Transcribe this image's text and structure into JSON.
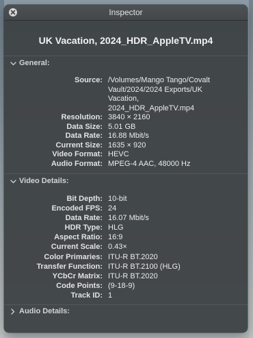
{
  "window": {
    "title": "Inspector",
    "file_name": "UK Vacation, 2024_HDR_AppleTV.mp4"
  },
  "general": {
    "header": "General:",
    "expanded": true,
    "source": {
      "label": "Source:",
      "lines": [
        "/Volumes/Mango Tango/Covalt",
        "Vault/2024/2024 Exports/UK",
        "Vacation,",
        "2024_HDR_AppleTV.mp4"
      ]
    },
    "rows": [
      {
        "label": "Resolution:",
        "value": "3840 × 2160"
      },
      {
        "label": "Data Size:",
        "value": "5.01 GB"
      },
      {
        "label": "Data Rate:",
        "value": "16.88 Mbit/s"
      },
      {
        "label": "Current Size:",
        "value": "1635 × 920"
      },
      {
        "label": "Video Format:",
        "value": "HEVC"
      },
      {
        "label": "Audio Format:",
        "value": "MPEG-4 AAC, 48000 Hz"
      }
    ]
  },
  "video_details": {
    "header": "Video Details:",
    "expanded": true,
    "rows": [
      {
        "label": "Bit Depth:",
        "value": "10-bit"
      },
      {
        "label": "Encoded FPS:",
        "value": "24"
      },
      {
        "label": "Data Rate:",
        "value": "16.07 Mbit/s"
      },
      {
        "label": "HDR Type:",
        "value": "HLG"
      },
      {
        "label": "Aspect Ratio:",
        "value": "16:9"
      },
      {
        "label": "Current Scale:",
        "value": "0.43×"
      },
      {
        "label": "Color Primaries:",
        "value": "ITU-R BT.2020"
      },
      {
        "label": "Transfer Function:",
        "value": "ITU-R BT.2100 (HLG)"
      },
      {
        "label": "YCbCr Matrix:",
        "value": "ITU-R BT.2020"
      },
      {
        "label": "Code Points:",
        "value": "(9-18-9)"
      },
      {
        "label": "Track ID:",
        "value": "1"
      }
    ]
  },
  "audio_details": {
    "header": "Audio Details:",
    "expanded": false
  },
  "icons": {
    "close": "close-icon",
    "expanded": "chevron-down-icon",
    "collapsed": "chevron-right-icon"
  }
}
